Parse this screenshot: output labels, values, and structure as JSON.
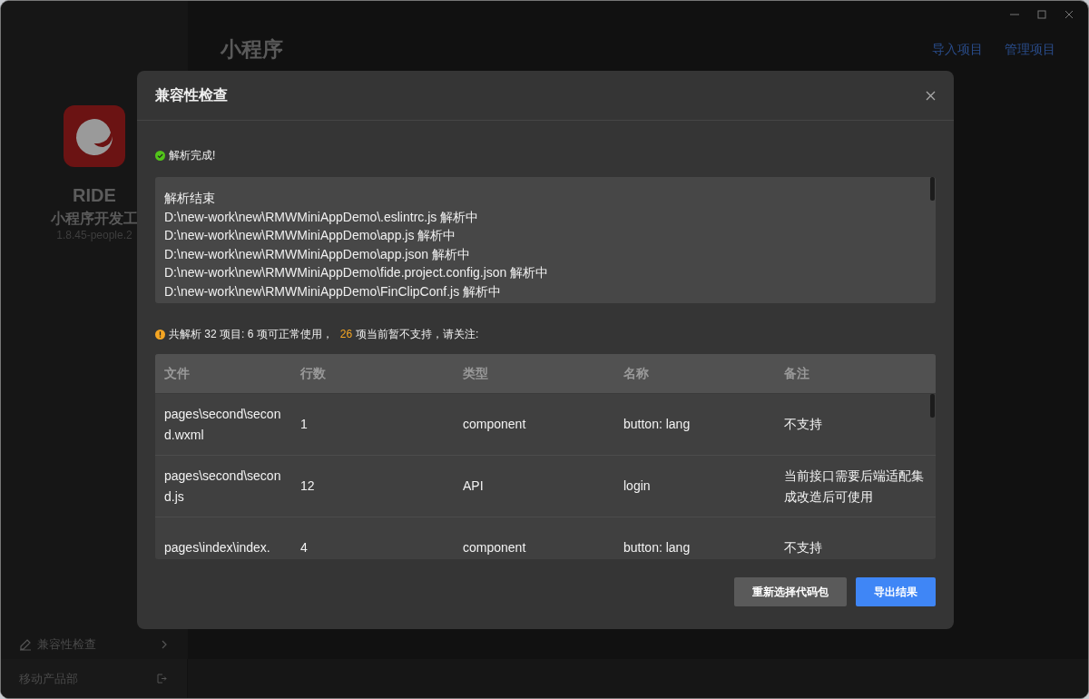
{
  "sidebar": {
    "app_name": "RIDE",
    "app_subtitle": "小程序开发工",
    "version": "1.8.45-people.2",
    "nav_items": [
      {
        "label": "兼容性检查"
      }
    ],
    "footer": {
      "label": "移动产品部"
    }
  },
  "header": {
    "title": "小程序",
    "links": [
      "导入项目",
      "管理项目"
    ]
  },
  "dialog": {
    "title": "兼容性检查",
    "status": "解析完成!",
    "log": [
      "解析结束",
      "D:\\new-work\\new\\RMWMiniAppDemo\\.eslintrc.js 解析中",
      "D:\\new-work\\new\\RMWMiniAppDemo\\app.js 解析中",
      "D:\\new-work\\new\\RMWMiniAppDemo\\app.json 解析中",
      "D:\\new-work\\new\\RMWMiniAppDemo\\fide.project.config.json 解析中",
      "D:\\new-work\\new\\RMWMiniAppDemo\\FinClipConf.js 解析中"
    ],
    "summary": {
      "prefix": "共解析 32 项目: 6 项可正常使用，",
      "count": "26",
      "suffix": "项当前暂不支持，请关注:"
    },
    "table": {
      "columns": [
        "文件",
        "行数",
        "类型",
        "名称",
        "备注"
      ],
      "rows": [
        [
          "pages\\second\\second.wxml",
          "1",
          "component",
          "button: lang",
          "不支持"
        ],
        [
          "pages\\second\\second.js",
          "12",
          "API",
          "login",
          "当前接口需要后端适配集成改造后可使用"
        ],
        [
          "pages\\index\\index.",
          "4",
          "component",
          "button: lang",
          "不支持"
        ]
      ]
    },
    "buttons": [
      {
        "label": "重新选择代码包",
        "kind": "secondary"
      },
      {
        "label": "导出结果",
        "kind": "primary"
      }
    ]
  }
}
